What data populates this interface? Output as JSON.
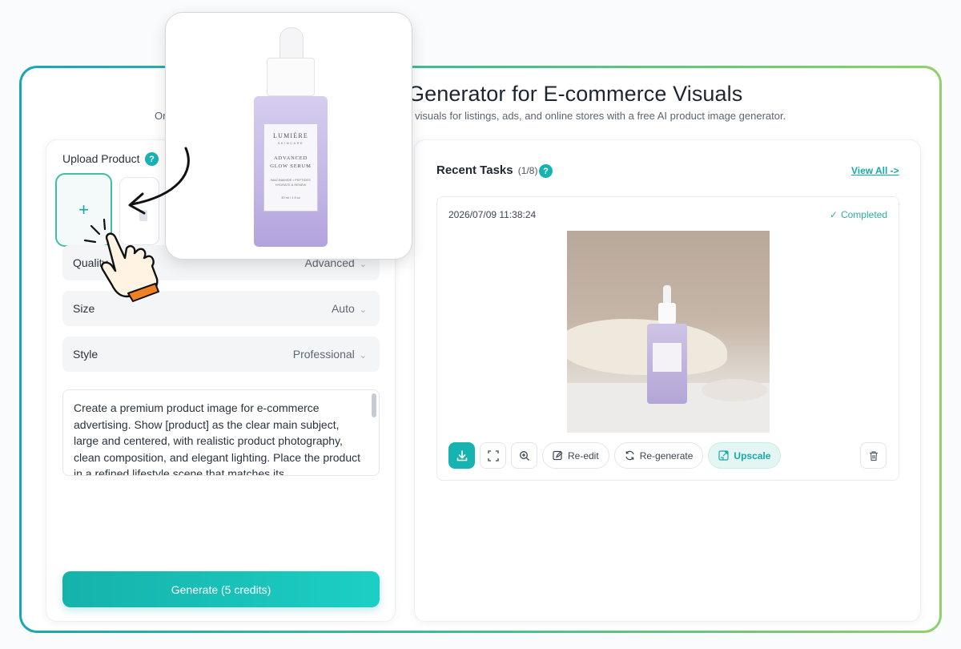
{
  "header": {
    "title": "Generator for E-commerce Visuals",
    "subtitle_stub": "Or",
    "subtitle": "visuals for listings, ads, and online stores with a free AI product image generator."
  },
  "upload": {
    "title": "Upload Product",
    "add_icon": "+"
  },
  "options": [
    {
      "label": "Quality",
      "value": "Advanced"
    },
    {
      "label": "Size",
      "value": "Auto"
    },
    {
      "label": "Style",
      "value": "Professional"
    }
  ],
  "prompt": {
    "text": "Create a premium product image for e-commerce advertising. Show [product] as the clear main subject, large and centered, with realistic product photography, clean composition, and elegant lighting. Place the product in a refined lifestyle scene that matches its"
  },
  "generate": {
    "label": "Generate (5 credits)"
  },
  "recent": {
    "title": "Recent Tasks",
    "count": "(1/8)",
    "view_all": "View All ->"
  },
  "task": {
    "timestamp": "2026/07/09 11:38:24",
    "status": "Completed",
    "actions": {
      "reedit": "Re-edit",
      "regenerate": "Re-generate",
      "upscale": "Upscale"
    }
  },
  "product": {
    "brand": "LUMIÈRE",
    "brand_sub": "SKINCARE",
    "name_line1": "ADVANCED",
    "name_line2": "GLOW SERUM",
    "desc_line1": "NIACINAMIDE • PEPTIDES",
    "desc_line2": "HYDRATE & RENEW",
    "size": "30 ml / 1 fl oz"
  },
  "colors": {
    "accent": "#17b3b0",
    "frame_start": "#1aa6b7",
    "frame_end": "#8fd16a",
    "status_green": "#2fae9b"
  },
  "icons": [
    "help-icon",
    "download-icon",
    "fullscreen-icon",
    "zoom-in-icon",
    "edit-icon",
    "refresh-icon",
    "upscale-icon",
    "trash-icon",
    "check-icon",
    "chevron-down-icon",
    "plus-icon",
    "arrow-icon",
    "hand-pointer-icon"
  ]
}
